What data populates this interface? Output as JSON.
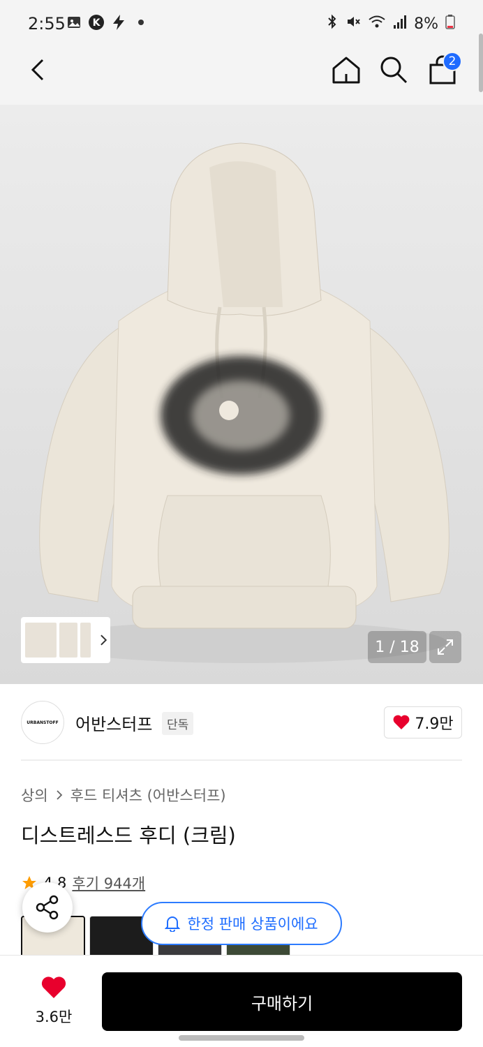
{
  "status_bar": {
    "time": "2:55",
    "battery": "8%",
    "left_icons": [
      "gallery-icon",
      "k-app-icon",
      "bolt-icon",
      "dot-icon"
    ],
    "right_icons": [
      "bluetooth-icon",
      "mute-icon",
      "wifi-icon",
      "signal-icon",
      "battery-icon"
    ]
  },
  "header": {
    "cart_count": "2",
    "icons": [
      "back-icon",
      "home-icon",
      "search-icon",
      "cart-icon"
    ],
    "accent": "#1f6bff"
  },
  "gallery": {
    "pager": "1 / 18",
    "icons": [
      "chevron-right-icon",
      "expand-icon"
    ]
  },
  "brand": {
    "logo_text": "URBANSTOFF",
    "name": "어반스터프",
    "tag": "단독",
    "likes": "7.9만"
  },
  "product": {
    "breadcrumb": [
      "상의",
      "후드 티셔츠 (어반스터프)"
    ],
    "title": "디스트레스드 후디 (크림)",
    "rating": "4.8",
    "review_link": "후기 944개"
  },
  "notice": {
    "limited_text": "한정 판매 상품이에요"
  },
  "bottom_bar": {
    "wish_count": "3.6만",
    "buy_label": "구매하기"
  },
  "colors": {
    "heart": "#e8002d",
    "star": "#ff9d00",
    "limited_border": "#2c7bff"
  }
}
